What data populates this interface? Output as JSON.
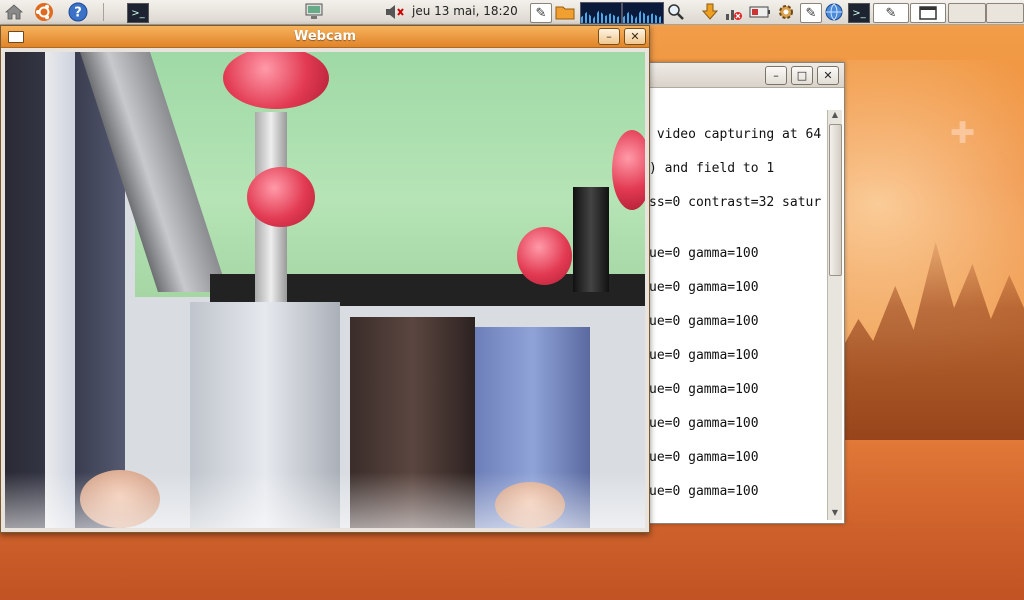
{
  "panel": {
    "clock": "jeu 13 mai, 18:20"
  },
  "webcam_window": {
    "title": "Webcam"
  },
  "terminal_window": {
    "lines": [
      " video capturing at 64",
      ") and field to 1",
      "ss=0 contrast=32 satur",
      "ue=0 gamma=100",
      "ue=0 gamma=100",
      "ue=0 gamma=100",
      "ue=0 gamma=100",
      "ue=0 gamma=100",
      "ue=0 gamma=100",
      "ue=0 gamma=100",
      "ue=0 gamma=100"
    ]
  },
  "colors": {
    "webcam_titlebar": "#e8902f",
    "panel": "#e8e4de",
    "desktop": "#ef9040"
  },
  "icons": {
    "home": "home-icon",
    "ubuntu": "ubuntu-logo-icon",
    "help": "help-icon",
    "terminal": "terminal-icon",
    "network": "network-icon",
    "volume": "volume-muted-icon",
    "search": "magnifier-icon"
  }
}
